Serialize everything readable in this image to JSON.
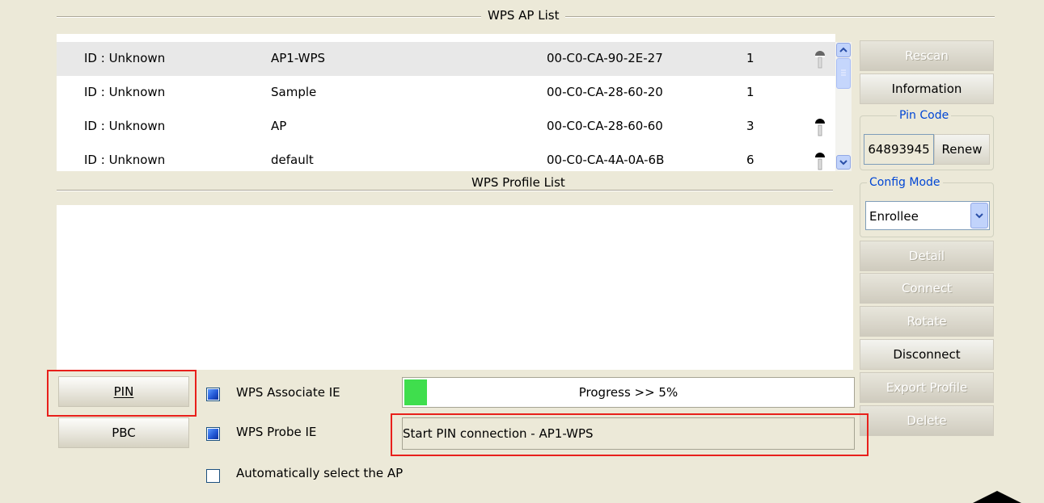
{
  "ap_list": {
    "title": "WPS AP List",
    "rows": [
      {
        "id": "ID : Unknown",
        "ssid": "AP1-WPS",
        "bssid": "00-C0-CA-90-2E-27",
        "channel": "1",
        "locked": true
      },
      {
        "id": "ID : Unknown",
        "ssid": "Sample",
        "bssid": "00-C0-CA-28-60-20",
        "channel": "1",
        "locked": false
      },
      {
        "id": "ID : Unknown",
        "ssid": "AP",
        "bssid": "00-C0-CA-28-60-60",
        "channel": "3",
        "locked": true
      },
      {
        "id": "ID : Unknown",
        "ssid": "default",
        "bssid": "00-C0-CA-4A-0A-6B",
        "channel": "6",
        "locked": true
      }
    ]
  },
  "profile_list": {
    "title": "WPS Profile List"
  },
  "side": {
    "rescan": "Rescan",
    "information": "Information",
    "pin_code_label": "Pin Code",
    "pin_code_value": "64893945",
    "renew": "Renew",
    "config_mode_label": "Config Mode",
    "config_mode_value": "Enrollee",
    "detail": "Detail",
    "connect": "Connect",
    "rotate": "Rotate",
    "disconnect": "Disconnect",
    "export_profile": "Export Profile",
    "delete": "Delete"
  },
  "bottom": {
    "pin_button": "PIN",
    "pbc_button": "PBC",
    "wps_associate_ie": "WPS Associate IE",
    "wps_probe_ie": "WPS Probe IE",
    "auto_select": "Automatically select the AP",
    "progress_text": "Progress >> 5%",
    "progress_fraction": 0.05,
    "status_text": "Start PIN connection - AP1-WPS"
  },
  "colors": {
    "window_bg": "#ece9d8",
    "highlight": "#e8201b",
    "progress_fill": "#3fde4d",
    "legend_blue": "#0046d5"
  }
}
